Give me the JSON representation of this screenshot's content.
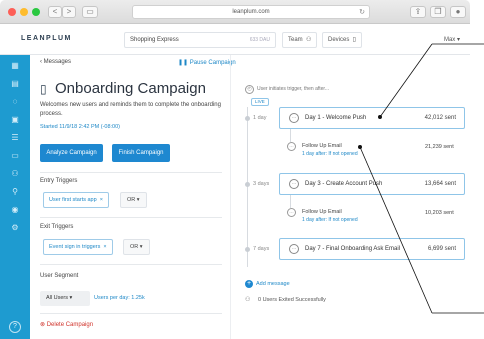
{
  "browser": {
    "url": "leanplum.com",
    "nav_back": "<",
    "nav_forward": ">",
    "reload_icon": "reload-icon",
    "colors": {
      "close": "#fd5f57",
      "minimize": "#febc2e",
      "zoom": "#2ac840"
    }
  },
  "header": {
    "logo": "LEANPLUM",
    "app_name": "Shopping Express",
    "dau": "633 DAU",
    "team_label": "Team",
    "devices_label": "Devices",
    "user_label": "Max"
  },
  "sidebar": {
    "accent_color": "#1e9bd0",
    "items": [
      "dashboard-icon",
      "analytics-icon",
      "messaging-icon",
      "ab-tests-icon",
      "variables-icon",
      "files-icon",
      "users-icon",
      "settings-icon",
      "help-icon"
    ]
  },
  "campaign": {
    "back_label": "Messages",
    "pause_label": "Pause Campaign",
    "title": "Onboarding Campaign",
    "description": "Welcomes new users and reminds them to complete the onboarding process.",
    "started": "Started 11/9/18 2:42 PM (-08:00)",
    "analyze_button": "Analyze Campaign",
    "finish_button": "Finish Campaign",
    "entry_triggers_label": "Entry Triggers",
    "entry_trigger": "User first starts app",
    "entry_op": "OR",
    "exit_triggers_label": "Exit Triggers",
    "exit_trigger": "Event sign in triggers",
    "exit_op": "OR",
    "segment_label": "User Segment",
    "segment_value": "All Users",
    "per_day": "Users per day: 1.25k",
    "delete_label": "Delete Campaign"
  },
  "flow": {
    "header": "User initiates trigger, then after...",
    "live_badge": "LIVE",
    "steps": [
      {
        "delay": "1 day",
        "label": "Day 1 - Welcome Push",
        "sent": "42,012 sent",
        "sub": {
          "title": "Follow Up Email",
          "meta": "1 day after: If not opened",
          "sent": "21,239 sent"
        }
      },
      {
        "delay": "3 days",
        "label": "Day 3 - Create Account Push",
        "sent": "13,664 sent",
        "sub": {
          "title": "Follow Up Email",
          "meta": "1 day after: If not opened",
          "sent": "10,203 sent"
        }
      },
      {
        "delay": "7 days",
        "label": "Day 7 - Final Onboarding Ask Email",
        "sent": "6,699 sent"
      }
    ],
    "add_message": "Add message",
    "exited": "0 Users Exited Successfully"
  }
}
